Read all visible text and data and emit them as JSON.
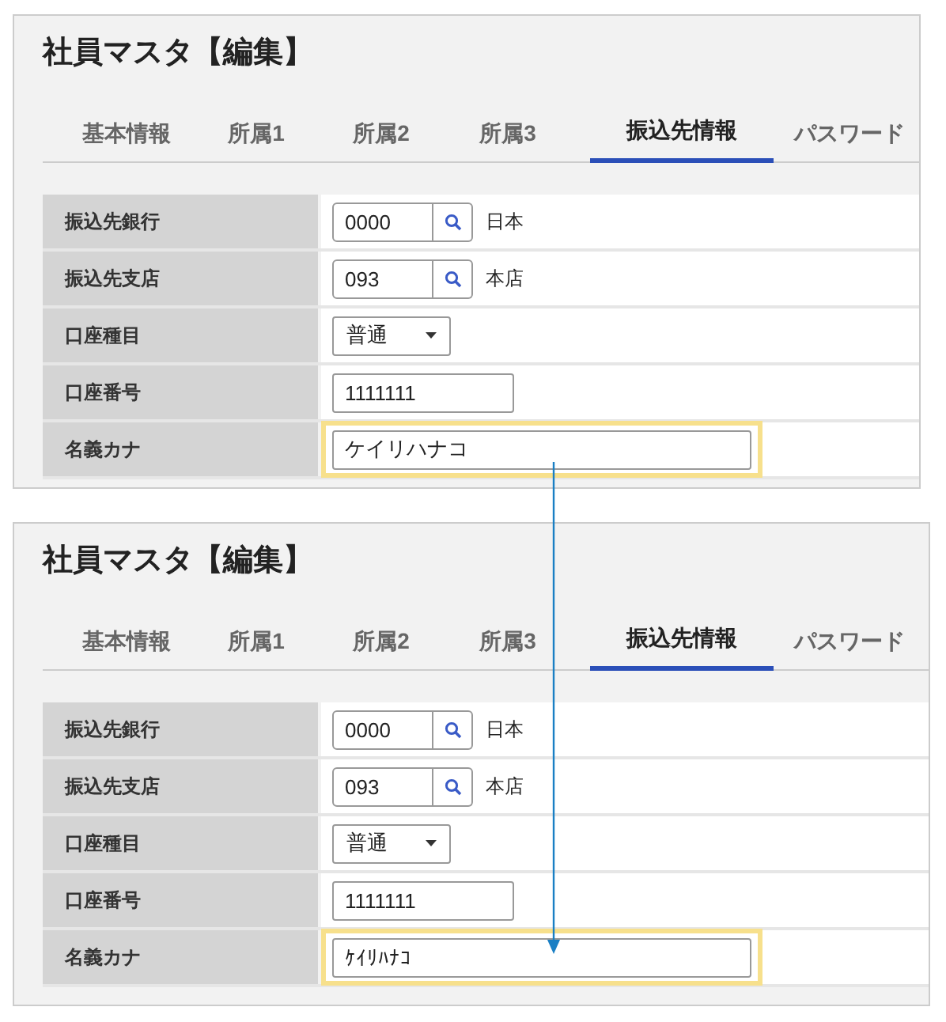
{
  "panels": [
    {
      "title": "社員マスタ【編集】",
      "tabs": [
        {
          "label": "基本情報",
          "selected": false
        },
        {
          "label": "所属1",
          "selected": false
        },
        {
          "label": "所属2",
          "selected": false
        },
        {
          "label": "所属3",
          "selected": false
        },
        {
          "label": "振込先情報",
          "selected": true
        },
        {
          "label": "パスワード",
          "selected": false
        }
      ],
      "rows": [
        {
          "kind": "lookup",
          "label": "振込先銀行",
          "value": "0000",
          "result": "日本"
        },
        {
          "kind": "lookup",
          "label": "振込先支店",
          "value": "093",
          "result": "本店"
        },
        {
          "kind": "select",
          "label": "口座種目",
          "value": "普通"
        },
        {
          "kind": "text",
          "label": "口座番号",
          "value": "1111111",
          "highlighted": false
        },
        {
          "kind": "wide",
          "label": "名義カナ",
          "value": "ケイリハナコ",
          "highlighted": true
        }
      ]
    },
    {
      "title": "社員マスタ【編集】",
      "tabs": [
        {
          "label": "基本情報",
          "selected": false
        },
        {
          "label": "所属1",
          "selected": false
        },
        {
          "label": "所属2",
          "selected": false
        },
        {
          "label": "所属3",
          "selected": false
        },
        {
          "label": "振込先情報",
          "selected": true
        },
        {
          "label": "パスワード",
          "selected": false
        }
      ],
      "rows": [
        {
          "kind": "lookup",
          "label": "振込先銀行",
          "value": "0000",
          "result": "日本"
        },
        {
          "kind": "lookup",
          "label": "振込先支店",
          "value": "093",
          "result": "本店"
        },
        {
          "kind": "select",
          "label": "口座種目",
          "value": "普通"
        },
        {
          "kind": "text",
          "label": "口座番号",
          "value": "1111111",
          "highlighted": false
        },
        {
          "kind": "wide",
          "label": "名義カナ",
          "value": "ｹｲﾘﾊﾅｺ",
          "highlighted": true
        }
      ]
    }
  ]
}
